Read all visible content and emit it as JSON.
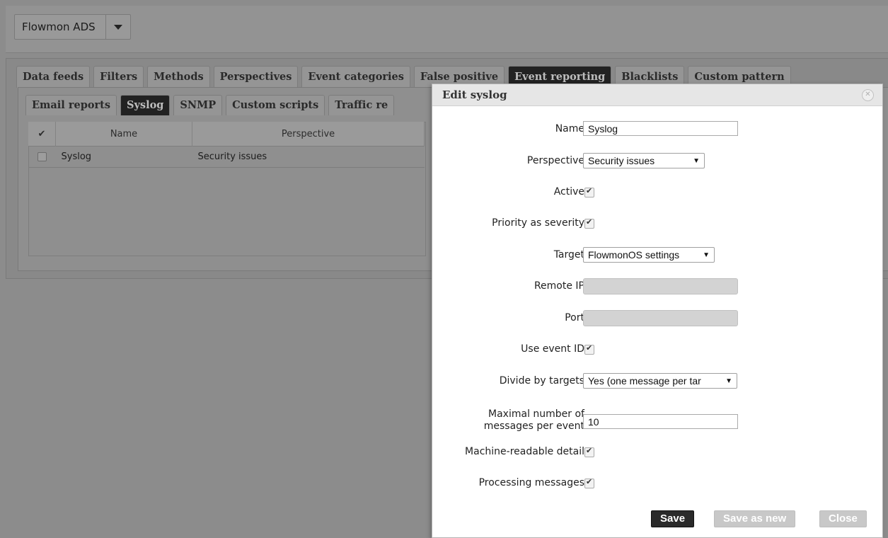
{
  "app": {
    "name": "Flowmon ADS"
  },
  "tabs": [
    "Data feeds",
    "Filters",
    "Methods",
    "Perspectives",
    "Event categories",
    "False positive",
    "Event reporting",
    "Blacklists",
    "Custom pattern"
  ],
  "active_tab": "Event reporting",
  "subtabs": [
    "Email reports",
    "Syslog",
    "SNMP",
    "Custom scripts",
    "Traffic re"
  ],
  "active_subtab": "Syslog",
  "table": {
    "header_check": "✔",
    "columns": [
      "Name",
      "Perspective"
    ],
    "rows": [
      {
        "name": "Syslog",
        "perspective": "Security issues"
      }
    ]
  },
  "dialog": {
    "title": "Edit syslog",
    "close_glyph": "✕",
    "fields": {
      "name": {
        "label": "Name",
        "value": "Syslog"
      },
      "perspective": {
        "label": "Perspective",
        "value": "Security issues"
      },
      "active": {
        "label": "Active",
        "checked": true
      },
      "priority": {
        "label": "Priority as severity",
        "checked": true
      },
      "target": {
        "label": "Target",
        "value": "FlowmonOS settings"
      },
      "remote_ip": {
        "label": "Remote IP",
        "value": ""
      },
      "port": {
        "label": "Port",
        "value": ""
      },
      "use_event_id": {
        "label": "Use event ID",
        "checked": true
      },
      "divide": {
        "label": "Divide by targets",
        "value": "Yes (one message per tar"
      },
      "max_messages": {
        "label_line1": "Maximal number of",
        "label_line2": "messages per event",
        "value": "10"
      },
      "machine_readable": {
        "label": "Machine-readable detail",
        "checked": true
      },
      "processing": {
        "label": "Processing messages",
        "checked": true
      }
    },
    "buttons": {
      "save": "Save",
      "save_as_new": "Save as new",
      "close": "Close"
    }
  }
}
